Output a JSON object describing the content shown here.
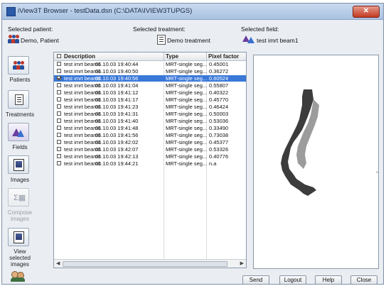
{
  "window": {
    "title": "iView3T Browser - testData.dsn (C:\\DATA\\IVIEW3TUPGS)"
  },
  "header": {
    "patient_label": "Selected patient:",
    "patient_value": "Demo, Patient",
    "treatment_label": "Selected treatment:",
    "treatment_value": "Demo treatment",
    "field_label": "Selected field:",
    "field_value": "test imrt beam1"
  },
  "toolbar": {
    "patients": "Patients",
    "treatments": "Treatments",
    "fields": "Fields",
    "images": "Images",
    "compose_1": "Compose",
    "compose_2": "images",
    "view_1": "View",
    "view_2": "selected",
    "view_3": "images"
  },
  "table": {
    "headers": [
      "Description",
      "Type",
      "Pixel factor"
    ],
    "rows": [
      {
        "desc": "test imrt beam1",
        "date": "06.10.03 19:40:44",
        "type": "MRT-single seg...",
        "pix": "0.45001",
        "checked": false,
        "selected": false
      },
      {
        "desc": "test imrt beam1",
        "date": "06.10.03 19:40:50",
        "type": "MRT-single seg...",
        "pix": "0.36272",
        "checked": false,
        "selected": false
      },
      {
        "desc": "test imrt beam1",
        "date": "06.10.03 19:40:56",
        "type": "MRT-single seg...",
        "pix": "0.60524",
        "checked": true,
        "selected": true
      },
      {
        "desc": "test imrt beam1",
        "date": "06.10.03 19:41:04",
        "type": "MRT-single seg...",
        "pix": "0.55807",
        "checked": false,
        "selected": false
      },
      {
        "desc": "test imrt beam1",
        "date": "06.10.03 19:41:12",
        "type": "MRT-single seg...",
        "pix": "0.40322",
        "checked": false,
        "selected": false
      },
      {
        "desc": "test imrt beam1",
        "date": "06.10.03 19:41:17",
        "type": "MRT-single seg...",
        "pix": "0.45770",
        "checked": false,
        "selected": false
      },
      {
        "desc": "test imrt beam1",
        "date": "06.10.03 19:41:23",
        "type": "MRT-single seg...",
        "pix": "0.46424",
        "checked": false,
        "selected": false
      },
      {
        "desc": "test imrt beam1",
        "date": "06.10.03 19:41:31",
        "type": "MRT-single seg...",
        "pix": "0.50003",
        "checked": false,
        "selected": false
      },
      {
        "desc": "test imrt beam1",
        "date": "06.10.03 19:41:40",
        "type": "MRT-single seg...",
        "pix": "0.53036",
        "checked": false,
        "selected": false
      },
      {
        "desc": "test imrt beam1",
        "date": "06.10.03 19:41:48",
        "type": "MRT-single seg...",
        "pix": "0.33490",
        "checked": false,
        "selected": false
      },
      {
        "desc": "test imrt beam1",
        "date": "06.10.03 19:41:56",
        "type": "MRT-single seg...",
        "pix": "0.73038",
        "checked": false,
        "selected": false
      },
      {
        "desc": "test imrt beam1",
        "date": "06.10.03 19:42:02",
        "type": "MRT-single seg...",
        "pix": "0.45377",
        "checked": false,
        "selected": false
      },
      {
        "desc": "test imrt beam1",
        "date": "06.10.03 19:42:07",
        "type": "MRT-single seg...",
        "pix": "0.53326",
        "checked": false,
        "selected": false
      },
      {
        "desc": "test imrt beam1",
        "date": "06.10.03 19:42:13",
        "type": "MRT-single seg...",
        "pix": "0.40776",
        "checked": false,
        "selected": false
      },
      {
        "desc": "test imrt beam1",
        "date": "06.10.03 19:44:21",
        "type": "MRT-single seg...",
        "pix": "n.a",
        "checked": false,
        "selected": false
      }
    ]
  },
  "buttons": {
    "send": "Send",
    "logout": "Logout",
    "help": "Help",
    "close": "Close"
  },
  "colors": {
    "selection": "#3a78d8",
    "preview_field": "#3c3c3c"
  }
}
